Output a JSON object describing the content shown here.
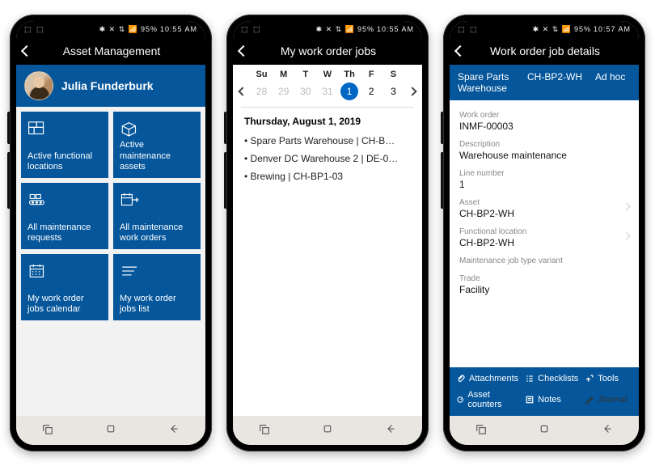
{
  "status": {
    "left_icons": "⬚ ⬚",
    "right_icons": "✱ ✕ ⇅ 📶",
    "battery": "95%",
    "time1": "10:55 AM",
    "time2": "10:55 AM",
    "time3": "10:57 AM"
  },
  "screen1": {
    "title": "Asset Management",
    "user": "Julia Funderburk",
    "tiles": [
      {
        "label": "Active functional locations"
      },
      {
        "label": "Active maintenance assets"
      },
      {
        "label": "All maintenance requests"
      },
      {
        "label": "All maintenance work orders"
      },
      {
        "label": "My work order jobs calendar"
      },
      {
        "label": "My work order jobs list"
      }
    ]
  },
  "screen2": {
    "title": "My work order jobs",
    "dow": [
      "Su",
      "M",
      "T",
      "W",
      "Th",
      "F",
      "S"
    ],
    "days": [
      "28",
      "29",
      "30",
      "31",
      "1",
      "2",
      "3"
    ],
    "selected_index": 4,
    "heading": "Thursday, August 1, 2019",
    "events": [
      "Spare Parts Warehouse | CH-B…",
      "Denver DC Warehouse 2 | DE-0…",
      "Brewing | CH-BP1-03"
    ]
  },
  "screen3": {
    "title": "Work order job details",
    "header": {
      "col1a": "Spare Parts",
      "col1b": "Warehouse",
      "col2": "CH-BP2-WH",
      "col3": "Ad hoc"
    },
    "fields": [
      {
        "label": "Work order",
        "value": "INMF-00003"
      },
      {
        "label": "Description",
        "value": "Warehouse maintenance"
      },
      {
        "label": "Line number",
        "value": "1"
      },
      {
        "label": "Asset",
        "value": "CH-BP2-WH",
        "nav": true
      },
      {
        "label": "Functional location",
        "value": "CH-BP2-WH",
        "nav": true
      },
      {
        "label": "Maintenance job type variant",
        "value": ""
      },
      {
        "label": "Trade",
        "value": "Facility"
      }
    ],
    "actions": [
      "Attachments",
      "Checklists",
      "Tools",
      "Asset counters",
      "Notes",
      "Journal"
    ]
  }
}
